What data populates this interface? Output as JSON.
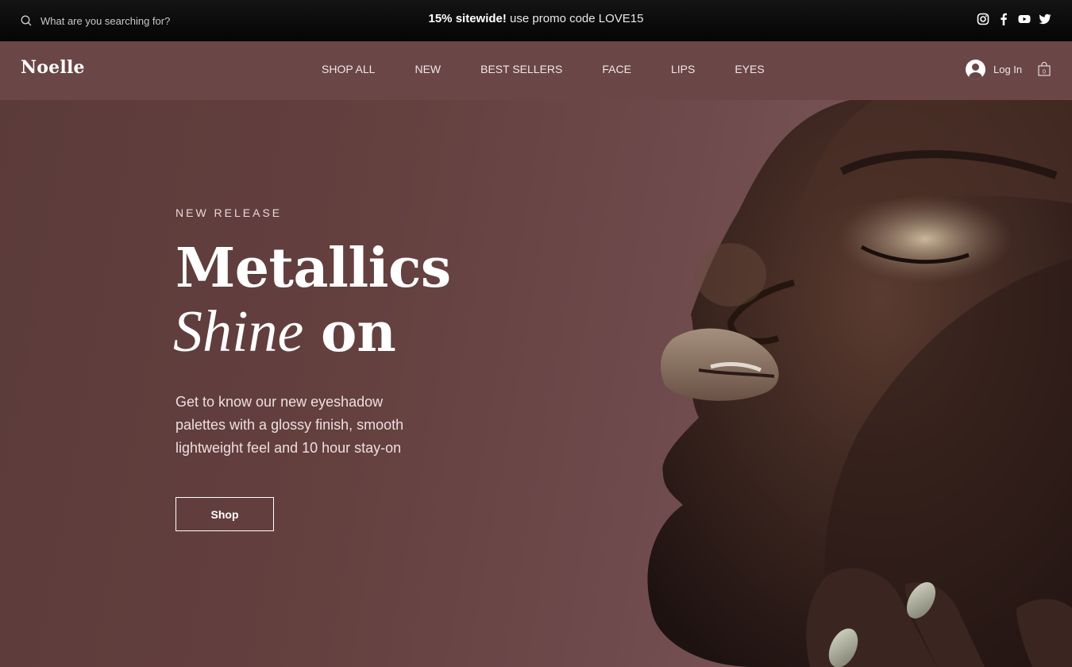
{
  "search": {
    "placeholder": "What are you searching for?"
  },
  "promo": {
    "bold": "15% sitewide!",
    "rest": " use promo code LOVE15"
  },
  "social": [
    "instagram-icon",
    "facebook-icon",
    "youtube-icon",
    "twitter-icon"
  ],
  "header": {
    "logo": "Noelle",
    "nav": [
      "SHOP ALL",
      "NEW",
      "BEST SELLERS",
      "FACE",
      "LIPS",
      "EYES"
    ],
    "login": "Log In",
    "cart_count": "0"
  },
  "hero": {
    "eyebrow": "NEW RELEASE",
    "title_line1": "Metallics",
    "title_italic": "Shine",
    "title_bold": "on",
    "description": "Get to know our new eyeshadow palettes with a glossy finish, smooth lightweight feel and 10 hour stay-on",
    "button": "Shop"
  },
  "colors": {
    "topbar": "#0a0a0a",
    "header": "#6a4646",
    "hero_bg": "#64403f",
    "text": "#ffffff"
  }
}
